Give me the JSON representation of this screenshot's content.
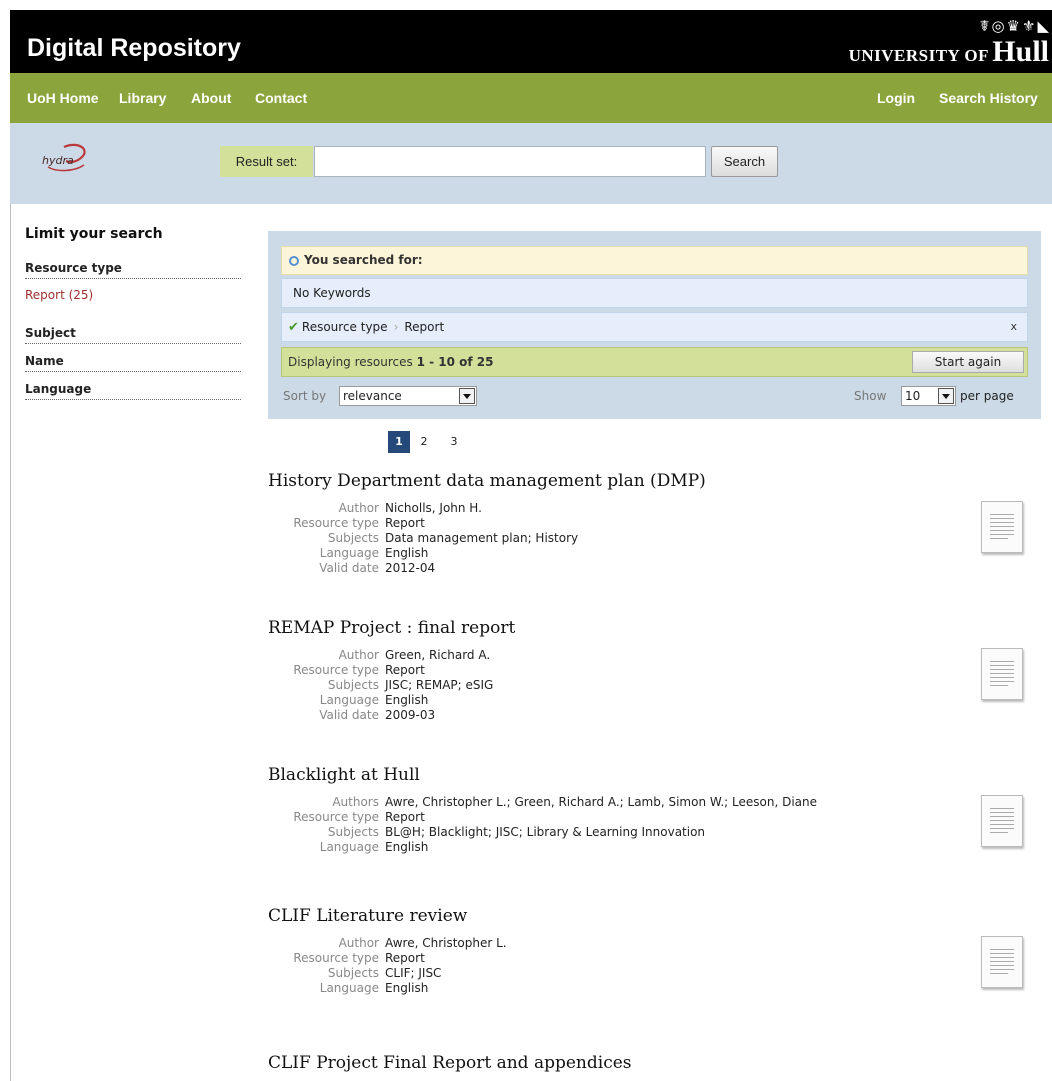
{
  "header": {
    "site_title": "Digital Repository",
    "crest_glyphs": "☤◎♛⚜◣",
    "uni_small": "UNIVERSITY OF",
    "uni_big": "Hull"
  },
  "nav": {
    "left": [
      "UoH Home",
      "Library",
      "About",
      "Contact"
    ],
    "right": [
      "Login",
      "Search History"
    ]
  },
  "search": {
    "logo_text": "hydra",
    "label": "Result set:",
    "value": "",
    "button": "Search"
  },
  "sidebar": {
    "heading": "Limit your search",
    "facets": [
      {
        "title": "Resource type",
        "values": [
          "Report (25)"
        ]
      },
      {
        "title": "Subject"
      },
      {
        "title": "Name"
      },
      {
        "title": "Language"
      }
    ]
  },
  "constraints": {
    "searched_for": "You searched for:",
    "no_keywords": "No Keywords",
    "filter_field": "Resource type",
    "filter_value": "Report",
    "remove": "x",
    "displaying_prefix": "Displaying resources",
    "displaying_range": "1 - 10 of 25",
    "start_again": "Start again",
    "sort_by": "Sort by",
    "sort_value": "relevance",
    "show": "Show",
    "per_page_value": "10",
    "per_page": "per page"
  },
  "pagination": {
    "pages": [
      "1",
      "2",
      "3"
    ],
    "current": "1"
  },
  "results": [
    {
      "title": "History Department data management plan (DMP)",
      "fields": [
        {
          "label": "Author",
          "value": "Nicholls, John H."
        },
        {
          "label": "Resource type",
          "value": "Report"
        },
        {
          "label": "Subjects",
          "value": "Data management plan; History"
        },
        {
          "label": "Language",
          "value": "English"
        },
        {
          "label": "Valid date",
          "value": "2012-04"
        }
      ]
    },
    {
      "title": "REMAP Project : final report",
      "fields": [
        {
          "label": "Author",
          "value": "Green, Richard A."
        },
        {
          "label": "Resource type",
          "value": "Report"
        },
        {
          "label": "Subjects",
          "value": "JISC; REMAP; eSIG"
        },
        {
          "label": "Language",
          "value": "English"
        },
        {
          "label": "Valid date",
          "value": "2009-03"
        }
      ]
    },
    {
      "title": "Blacklight at Hull",
      "fields": [
        {
          "label": "Authors",
          "value": "Awre, Christopher L.; Green, Richard A.; Lamb, Simon W.; Leeson, Diane"
        },
        {
          "label": "Resource type",
          "value": "Report"
        },
        {
          "label": "Subjects",
          "value": "BL@H; Blacklight; JISC; Library & Learning Innovation"
        },
        {
          "label": "Language",
          "value": "English"
        }
      ]
    },
    {
      "title": "CLIF Literature review",
      "fields": [
        {
          "label": "Author",
          "value": "Awre, Christopher L."
        },
        {
          "label": "Resource type",
          "value": "Report"
        },
        {
          "label": "Subjects",
          "value": "CLIF; JISC"
        },
        {
          "label": "Language",
          "value": "English"
        }
      ]
    },
    {
      "title": "CLIF Project Final Report and appendices",
      "fields": []
    }
  ]
}
